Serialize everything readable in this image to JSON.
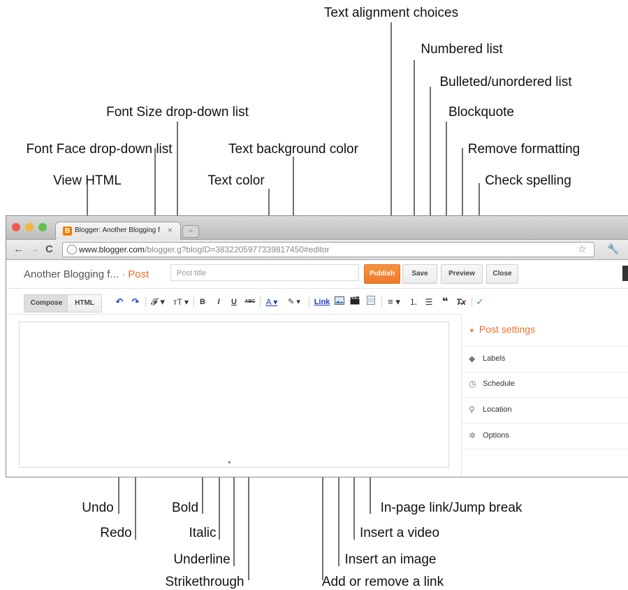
{
  "callouts": {
    "text_alignment": "Text alignment choices",
    "numbered_list": "Numbered list",
    "bulleted_list": "Bulleted/unordered list",
    "font_size": "Font Size drop-down list",
    "blockquote": "Blockquote",
    "font_face": "Font Face drop-down list",
    "text_bg_color": "Text background color",
    "remove_formatting": "Remove formatting",
    "view_html": "View HTML",
    "text_color": "Text color",
    "check_spelling": "Check spelling",
    "undo": "Undo",
    "redo": "Redo",
    "bold": "Bold",
    "italic": "Italic",
    "underline": "Underline",
    "strikethrough": "Strikethrough",
    "jump_break": "In-page link/Jump break",
    "insert_video": "Insert a video",
    "insert_image": "Insert an image",
    "add_link": "Add or remove a link"
  },
  "browser": {
    "tab_title": "Blogger: Another Blogging f",
    "tab_favicon": "B",
    "tab_close": "×",
    "url_host": "www.blogger.com",
    "url_path": "/blogger.g?blogID=3832205977339817450#editor"
  },
  "app": {
    "blog_name": "Another Blogging f...",
    "crumb_sep": " · ",
    "post_crumb": "Post",
    "title_placeholder": "Post title",
    "publish": "Publish",
    "save": "Save",
    "preview": "Preview",
    "close": "Close"
  },
  "toolbar": {
    "compose": "Compose",
    "html": "HTML",
    "undo": "↶",
    "redo": "↷",
    "font_face": "𝓕 ▾",
    "font_size": "тT ▾",
    "bold": "B",
    "italic": "I",
    "underline": "U",
    "strike": "ABC",
    "text_color": "A ▾",
    "bg_color": "✎ ▾",
    "link": "Link",
    "align": "≡ ▾",
    "numbered": "⒈",
    "bulleted": "☰",
    "blockquote": "❝",
    "remove_format": "T̶x",
    "spell": "✓"
  },
  "sidebar": {
    "heading": "Post settings",
    "items": [
      {
        "label": "Labels",
        "icon": "◆"
      },
      {
        "label": "Schedule",
        "icon": "◷"
      },
      {
        "label": "Location",
        "icon": "⚲"
      },
      {
        "label": "Options",
        "icon": "✲"
      }
    ]
  },
  "colors": {
    "accent": "#f06e2a",
    "publish": "#ee7a2b",
    "link": "#1a3fbf"
  }
}
